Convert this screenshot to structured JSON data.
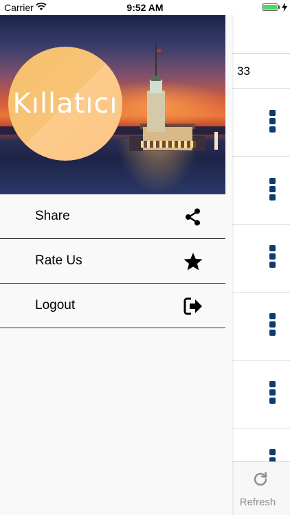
{
  "status_bar": {
    "carrier": "Carrier",
    "time": "9:52 AM",
    "battery_level": 1.0,
    "battery_color": "#4cd964",
    "icons": [
      "wifi-icon",
      "battery-icon",
      "charging-icon"
    ]
  },
  "drawer": {
    "header": {
      "logo_text": "Kıllatıcı",
      "logo_colors": [
        "#f6c06c",
        "#fccb8a"
      ]
    },
    "items": [
      {
        "label": "Share",
        "icon": "share-icon"
      },
      {
        "label": "Rate Us",
        "icon": "star-icon"
      },
      {
        "label": "Logout",
        "icon": "logout-icon"
      }
    ]
  },
  "main": {
    "header_text": "33",
    "row_menu_icon": "more-vertical-icon",
    "row_menu_color": "#0f3c6e",
    "footer": {
      "refresh_label": "Refresh",
      "refresh_icon": "refresh-icon"
    }
  }
}
